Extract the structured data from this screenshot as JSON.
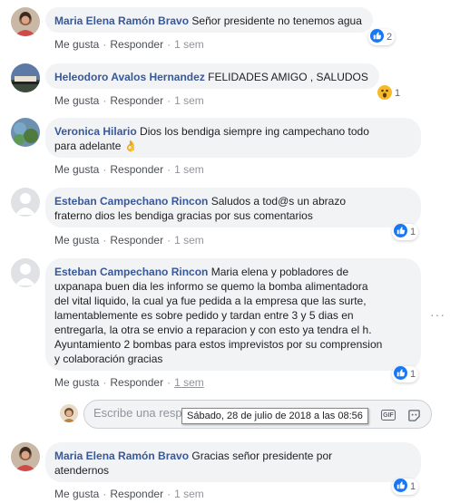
{
  "comments": [
    {
      "author": "Maria Elena Ramón Bravo",
      "text": "Señor presidente no tenemos agua",
      "like": "Me gusta",
      "reply": "Responder",
      "time": "1 sem",
      "reaction": {
        "icon": "like-icon",
        "count": "2"
      }
    },
    {
      "author": "Heleodoro Avalos Hernandez",
      "text": "FELIDADES AMIGO , SALUDOS",
      "like": "Me gusta",
      "reply": "Responder",
      "time": "1 sem",
      "reaction": {
        "icon": "wow-icon",
        "count": "1"
      }
    },
    {
      "author": "Veronica Hilario",
      "text_line1": "Dios los bendiga siempre ing campechano todo",
      "text_line2": "para adelante",
      "emoji": "👌",
      "like": "Me gusta",
      "reply": "Responder",
      "time": "1 sem"
    },
    {
      "author": "Esteban Campechano Rincon",
      "text_line1": "Saludos a tod@s un abrazo",
      "text_line2": "fraterno dios les bendiga gracias por sus comentarios",
      "like": "Me gusta",
      "reply": "Responder",
      "time": "1 sem",
      "reaction": {
        "icon": "like-icon",
        "count": "1"
      }
    },
    {
      "author": "Esteban Campechano Rincon",
      "text_line1": "Maria elena y pobladores de",
      "lines": [
        "uxpanapa buen dia les informo se quemo la bomba alimentadora",
        "del vital liquido, la cual ya fue pedida a la empresa que las surte,",
        "lamentablemente es sobre pedido y tardan entre 3 y 5 dias en",
        "entregarla, la otra se envio a reparacion y con esto ya tendra el h.",
        "Ayuntamiento 2 bombas para estos imprevistos por su comprension",
        "y colaboración gracias"
      ],
      "like": "Me gusta",
      "reply": "Responder",
      "time": "1 sem",
      "reaction": {
        "icon": "like-icon",
        "count": "1"
      }
    },
    {
      "author": "Maria Elena Ramón Bravo",
      "text_line1": "Gracias señor presidente por",
      "text_line2": "atendernos",
      "like": "Me gusta",
      "reply": "Responder",
      "time": "1 sem",
      "reaction": {
        "icon": "like-icon",
        "count": "1"
      }
    }
  ],
  "composer": {
    "placeholder": "Escribe una resp",
    "tooltip": "Sábado, 28 de julio de 2018 a las 08:56",
    "gif_label": "GIF"
  },
  "colors": {
    "author": "#385898",
    "bubble": "#f2f3f5",
    "like_blue": "#1877f2"
  }
}
